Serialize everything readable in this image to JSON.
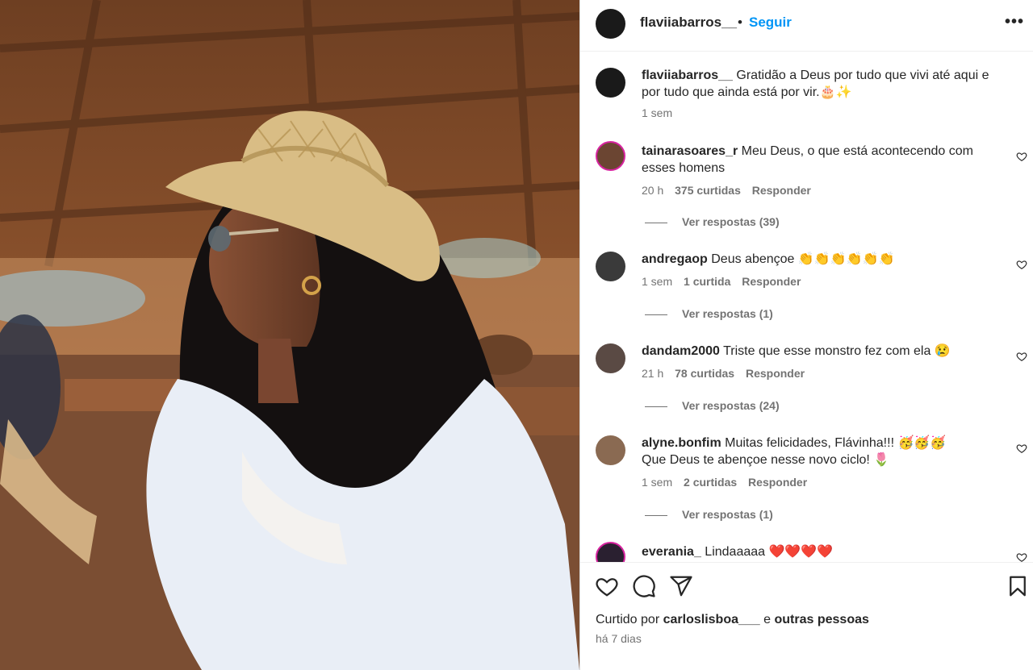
{
  "header": {
    "username": "flaviiabarros__",
    "separator": "•",
    "follow": "Seguir",
    "more": "•••"
  },
  "caption": {
    "username": "flaviiabarros__",
    "text": "Gratidão a Deus por tudo que vivi até aqui e por tudo que ainda está por vir.🎂✨",
    "time": "1 sem"
  },
  "comments": [
    {
      "username": "tainarasoares_r",
      "text": "Meu Deus, o que está acontecendo com esses homens",
      "time": "20 h",
      "likes": "375 curtidas",
      "reply": "Responder",
      "replies": "Ver respostas (39)"
    },
    {
      "username": "andregaop",
      "text": "Deus abençoe 👏👏👏👏👏👏",
      "time": "1 sem",
      "likes": "1 curtida",
      "reply": "Responder",
      "replies": "Ver respostas (1)"
    },
    {
      "username": "dandam2000",
      "text": "Triste que esse monstro fez com ela 😢",
      "time": "21 h",
      "likes": "78 curtidas",
      "reply": "Responder",
      "replies": "Ver respostas (24)"
    },
    {
      "username": "alyne.bonfim",
      "text": "Muitas felicidades, Flávinha!!! 🥳🥳🥳 Que Deus te abençoe nesse novo ciclo! 🌷",
      "time": "1 sem",
      "likes": "2 curtidas",
      "reply": "Responder",
      "replies": "Ver respostas (1)"
    },
    {
      "username": "everania_",
      "text": "Lindaaaaa ❤️❤️❤️❤️"
    }
  ],
  "footer": {
    "liked_prefix": "Curtido por",
    "liked_user": "carloslisboa___",
    "liked_join": "e",
    "liked_others": "outras pessoas",
    "ago": "há 7 dias"
  },
  "icons": {
    "like": "heart-icon",
    "comment": "comment-icon",
    "share": "send-icon",
    "save": "bookmark-icon",
    "more": "more-options-icon",
    "comment_like": "heart-icon"
  },
  "colors": {
    "link": "#0095f6",
    "text": "#262626",
    "muted": "#737373",
    "border": "#dbdbdb"
  }
}
